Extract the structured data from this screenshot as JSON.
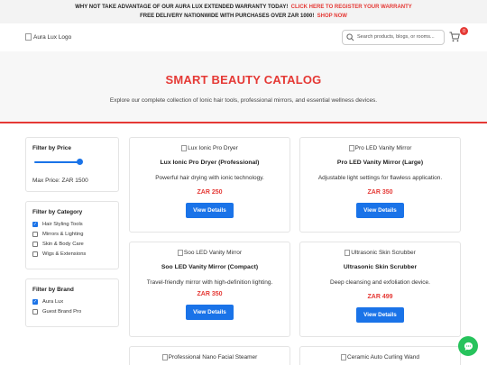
{
  "announcement": {
    "line1_text": "WHY NOT TAKE ADVANTAGE OF OUR AURA LUX EXTENDED WARRANTY TODAY!",
    "line1_link": "CLICK HERE TO REGISTER YOUR WARRANTY",
    "line2_text": "FREE DELIVERY NATIONWIDE WITH PURCHASES OVER ZAR 1000!",
    "line2_link": "SHOP NOW"
  },
  "header": {
    "logo_alt": "Aura Lux Logo",
    "search_placeholder": "Search products, blogs, or rooms...",
    "cart_count": "0"
  },
  "hero": {
    "title": "SMART BEAUTY CATALOG",
    "subtitle": "Explore our complete collection of Ionic hair tools, professional mirrors, and essential wellness devices."
  },
  "filters": {
    "price": {
      "title": "Filter by Price",
      "label": "Max Price: ZAR 1500",
      "slider_fraction": 1.0
    },
    "category": {
      "title": "Filter by Category",
      "options": [
        {
          "label": "Hair Styling Tools",
          "checked": true
        },
        {
          "label": "Mirrors & Lighting",
          "checked": false
        },
        {
          "label": "Skin & Body Care",
          "checked": false
        },
        {
          "label": "Wigs & Extensions",
          "checked": false
        }
      ]
    },
    "brand": {
      "title": "Filter by Brand",
      "options": [
        {
          "label": "Aura Lux",
          "checked": true
        },
        {
          "label": "Guest Brand Pro",
          "checked": false
        }
      ]
    }
  },
  "products": [
    {
      "img_alt": "Lux Ionic Pro Dryer",
      "name": "Lux Ionic Pro Dryer (Professional)",
      "desc": "Powerful hair drying with ionic technology.",
      "price": "ZAR 250",
      "button": "View Details"
    },
    {
      "img_alt": "Pro LED Vanity Mirror",
      "name": "Pro LED Vanity Mirror (Large)",
      "desc": "Adjustable light settings for flawless application.",
      "price": "ZAR 350",
      "button": "View Details"
    },
    {
      "img_alt": "Soo LED Vanity Mirror",
      "name": "Soo LED Vanity Mirror (Compact)",
      "desc": "Travel-friendly mirror with high-definition lighting.",
      "price": "ZAR 350",
      "button": "View Details"
    },
    {
      "img_alt": "Ultrasonic Skin Scrubber",
      "name": "Ultrasonic Skin Scrubber",
      "desc": "Deep cleansing and exfoliation device.",
      "price": "ZAR 499",
      "button": "View Details"
    },
    {
      "img_alt": "Professional Nano Facial Steamer"
    },
    {
      "img_alt": "Ceramic Auto Curling Wand"
    }
  ],
  "colors": {
    "accent": "#e53935",
    "primary": "#1a73e8",
    "chat": "#27c35c"
  }
}
